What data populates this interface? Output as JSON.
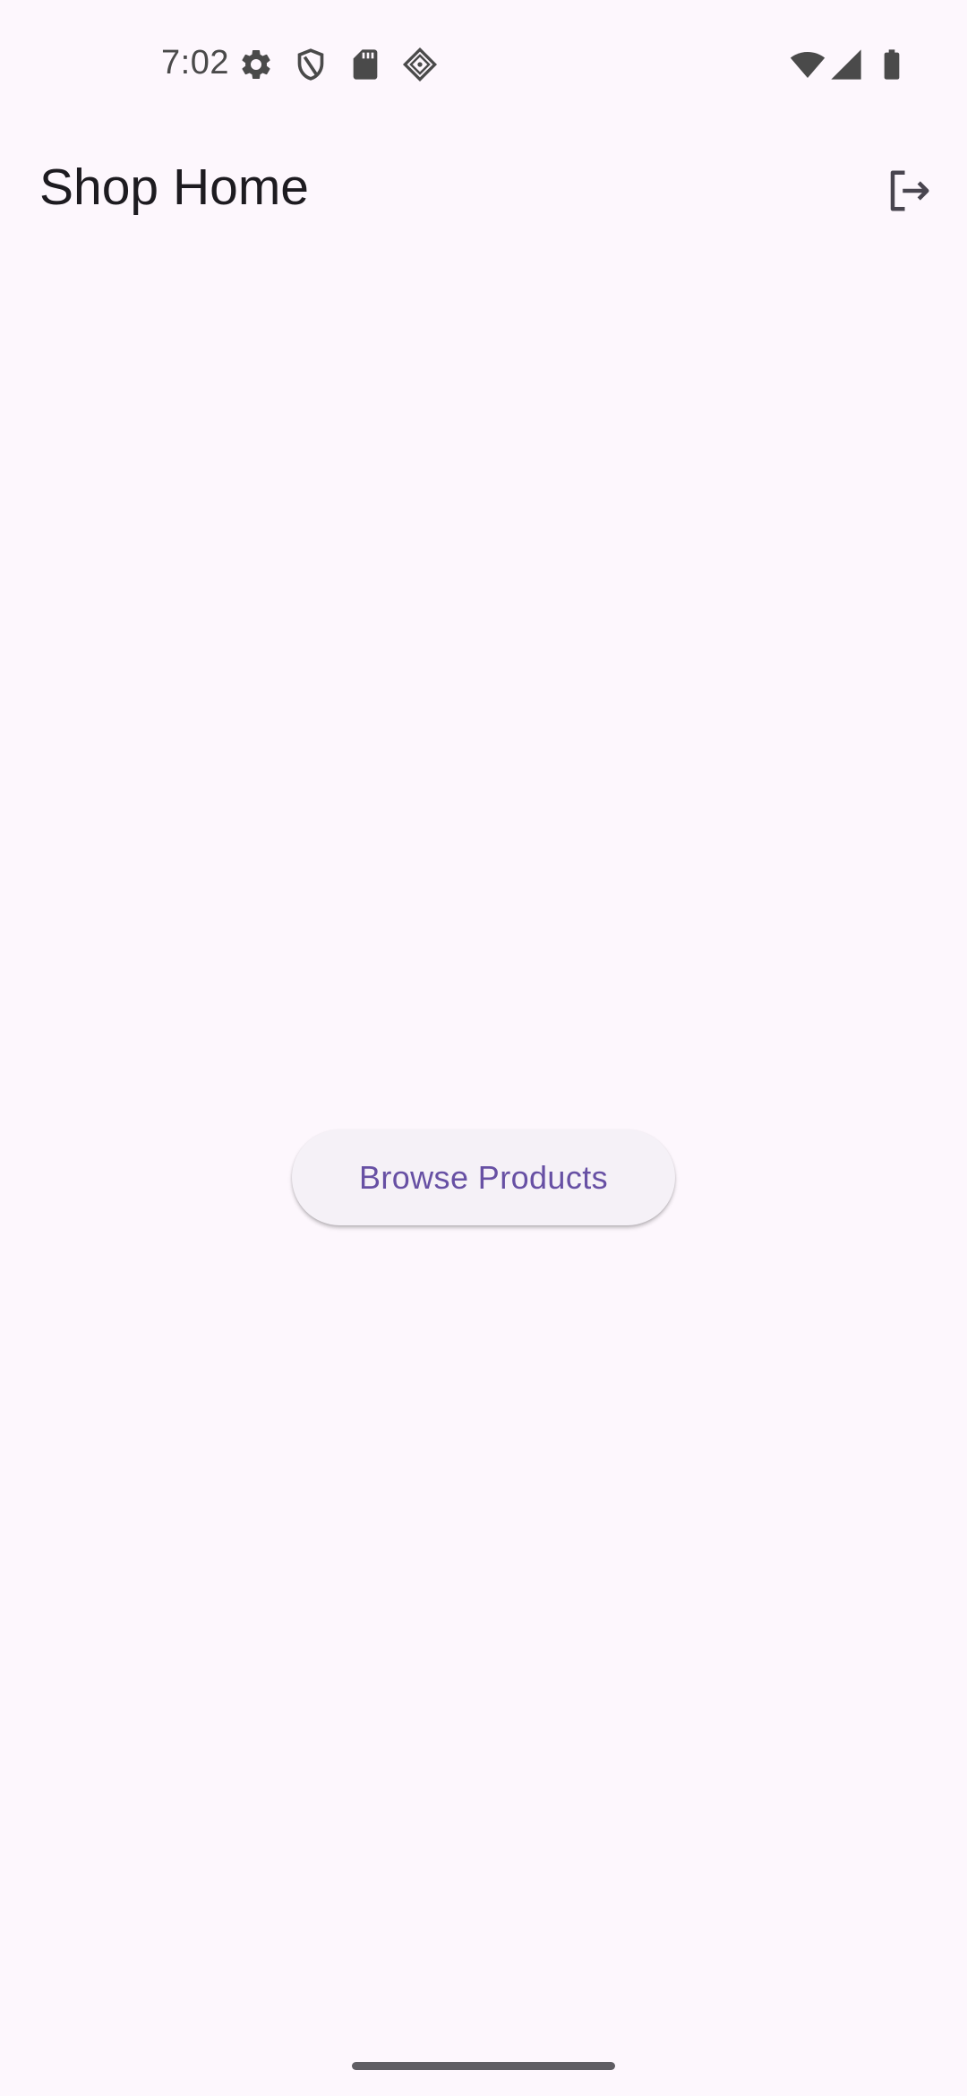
{
  "status_bar": {
    "time": "7:02",
    "left_icons": [
      "settings-icon",
      "shield-icon",
      "sd-card-icon",
      "data-saver-icon"
    ],
    "right_icons": [
      "wifi-icon",
      "cellular-signal-icon",
      "battery-icon"
    ]
  },
  "app_bar": {
    "title": "Shop Home",
    "action_icon": "logout-icon"
  },
  "main": {
    "browse_button_label": "Browse Products"
  },
  "colors": {
    "background": "#FDF7FD",
    "button_background": "#F5F1F7",
    "accent": "#6750A4",
    "title_text": "#1D1B20",
    "icon": "#49454F"
  }
}
